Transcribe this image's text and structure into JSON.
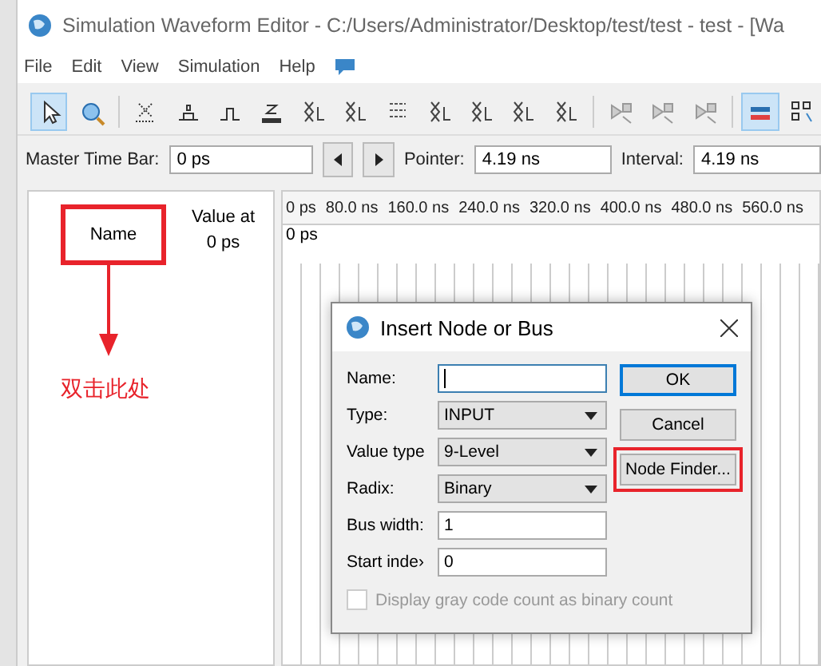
{
  "window": {
    "title": "Simulation Waveform Editor - C:/Users/Administrator/Desktop/test/test - test - [Wa"
  },
  "menu": [
    "File",
    "Edit",
    "View",
    "Simulation",
    "Help"
  ],
  "toolbar": [
    {
      "kind": "pointer",
      "selected": true
    },
    {
      "kind": "zoom",
      "selected": false
    },
    {
      "kind": "sep"
    },
    {
      "kind": "x",
      "selected": false
    },
    {
      "kind": "low",
      "selected": false
    },
    {
      "kind": "high",
      "selected": false
    },
    {
      "kind": "z",
      "selected": false
    },
    {
      "kind": "wave",
      "selected": false
    },
    {
      "kind": "wave",
      "selected": false
    },
    {
      "kind": "inv",
      "selected": false
    },
    {
      "kind": "wave",
      "selected": false
    },
    {
      "kind": "wave",
      "selected": false
    },
    {
      "kind": "wave",
      "selected": false
    },
    {
      "kind": "wave",
      "selected": false
    },
    {
      "kind": "sep"
    },
    {
      "kind": "sim",
      "selected": false
    },
    {
      "kind": "sim",
      "selected": false
    },
    {
      "kind": "sim",
      "selected": false
    },
    {
      "kind": "sep"
    },
    {
      "kind": "bars",
      "selected": true
    },
    {
      "kind": "grid",
      "selected": false
    }
  ],
  "time_bar": {
    "master_label": "Master Time Bar:",
    "master_value": "0 ps",
    "pointer_label": "Pointer:",
    "pointer_value": "4.19 ns",
    "interval_label": "Interval:",
    "interval_value": "4.19 ns"
  },
  "node_pane": {
    "name_header": "Name",
    "value_header": "Value at\n0 ps"
  },
  "waveform": {
    "ticks": [
      "0 ps",
      "80.0 ns",
      "160.0 ns",
      "240.0 ns",
      "320.0 ns",
      "400.0 ns",
      "480.0 ns",
      "560.0 ns"
    ],
    "marker": "0 ps"
  },
  "annotation": {
    "text": "双击此处"
  },
  "dialog": {
    "title": "Insert Node or Bus",
    "fields": [
      {
        "label": "Name:",
        "kind": "text"
      },
      {
        "label": "Type:",
        "kind": "select",
        "value": "INPUT"
      },
      {
        "label": "Value type",
        "kind": "select",
        "value": "9-Level"
      },
      {
        "label": "Radix:",
        "kind": "select",
        "value": "Binary"
      },
      {
        "label": "Bus width:",
        "kind": "text",
        "value": "1"
      },
      {
        "label": "Start inde›",
        "kind": "text",
        "value": "0"
      }
    ],
    "buttons": [
      {
        "label": "OK",
        "default": true,
        "highlighted": false
      },
      {
        "label": "Cancel",
        "default": false,
        "highlighted": false
      },
      {
        "label": "Node Finder...",
        "default": false,
        "highlighted": true
      }
    ],
    "checkbox": {
      "label": "Display gray code count as binary count",
      "checked": false,
      "disabled": true
    }
  }
}
